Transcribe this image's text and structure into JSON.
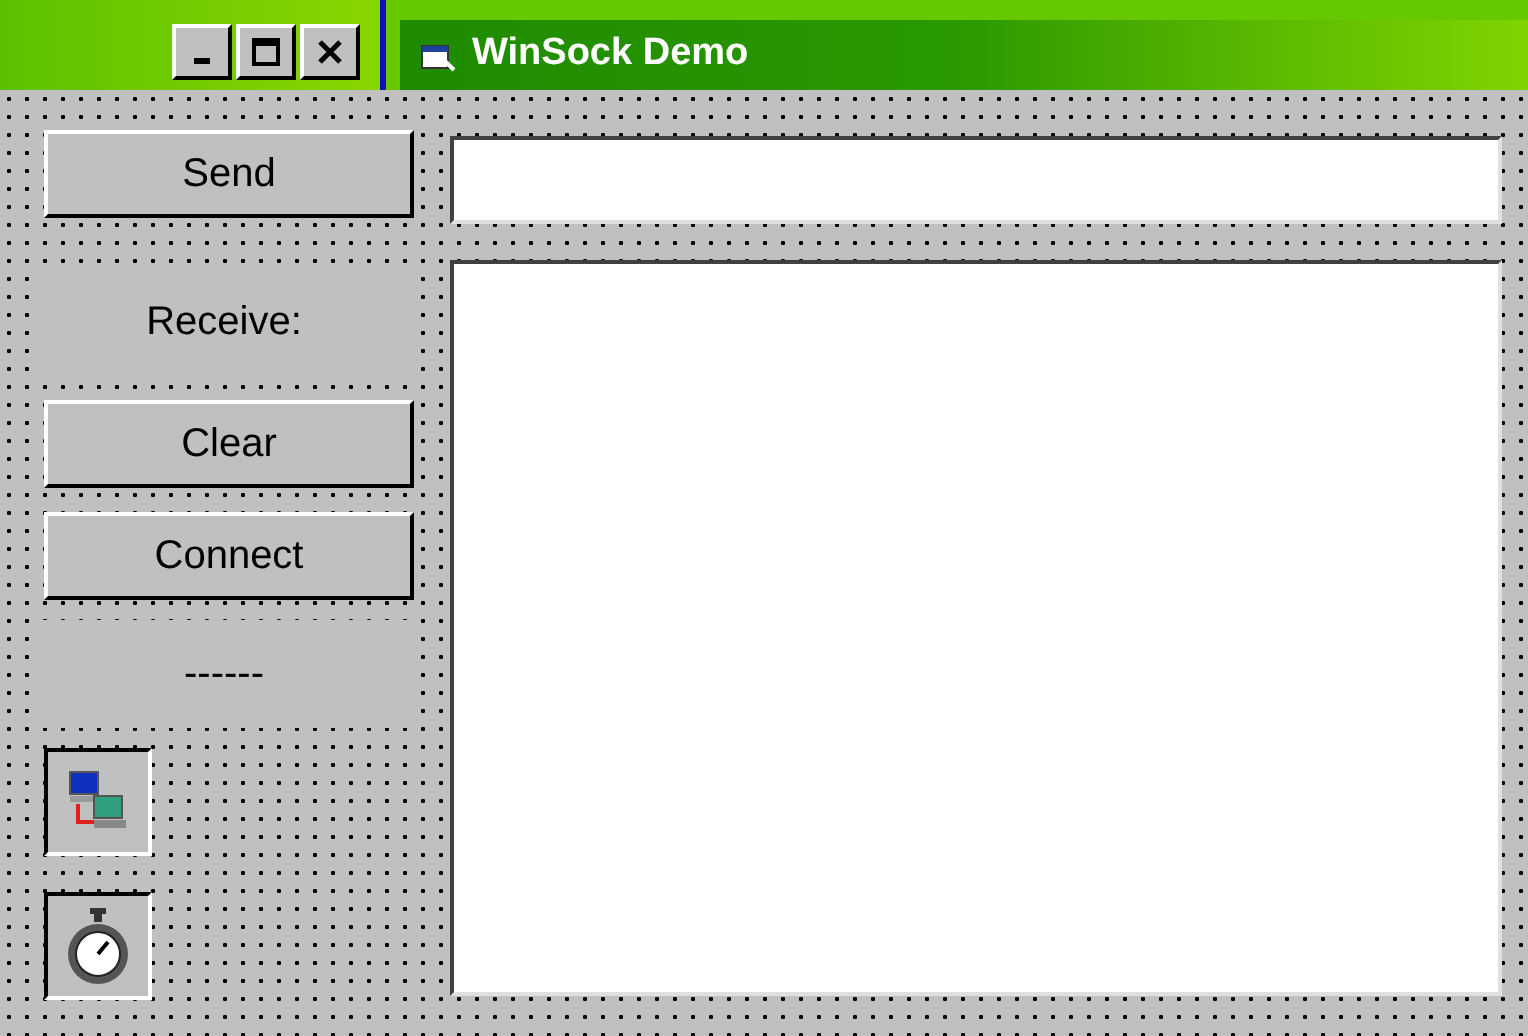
{
  "window": {
    "title": "WinSock Demo"
  },
  "controls": [
    {
      "kind": "button",
      "label": "Send"
    },
    {
      "kind": "label",
      "text": "Receive:"
    },
    {
      "kind": "button",
      "label": "Clear"
    },
    {
      "kind": "button",
      "label": "Connect"
    },
    {
      "kind": "label",
      "text": "------"
    },
    {
      "kind": "winsock"
    },
    {
      "kind": "timer"
    }
  ]
}
